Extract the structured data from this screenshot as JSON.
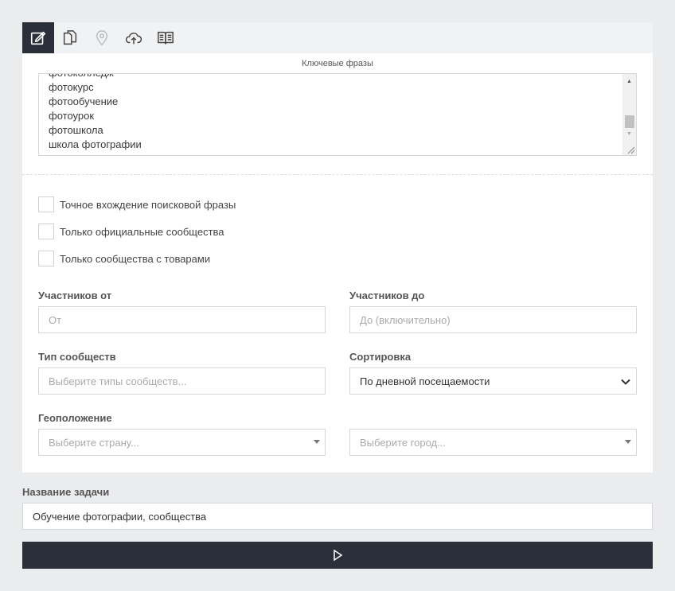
{
  "toolbar": {
    "tools": [
      {
        "icon": "edit-icon",
        "active": true
      },
      {
        "icon": "copy-icon",
        "active": false
      },
      {
        "icon": "location-pin-icon",
        "active": false
      },
      {
        "icon": "cloud-upload-icon",
        "active": false
      },
      {
        "icon": "book-icon",
        "active": false
      }
    ]
  },
  "keywords": {
    "label": "Ключевые фразы",
    "lines": [
      "фотоколледж",
      "фотокурс",
      "фотообучение",
      "фотоурок",
      "фотошкола",
      "школа фотографии"
    ]
  },
  "checkboxes": [
    {
      "label": "Точное вхождение поисковой фразы",
      "checked": false
    },
    {
      "label": "Только официальные сообщества",
      "checked": false
    },
    {
      "label": "Только сообщества с товарами",
      "checked": false
    }
  ],
  "members_from": {
    "label": "Участников от",
    "placeholder": "От"
  },
  "members_to": {
    "label": "Участников до",
    "placeholder": "До (включительно)"
  },
  "community_type": {
    "label": "Тип сообществ",
    "placeholder": "Выберите типы сообществ..."
  },
  "sorting": {
    "label": "Сортировка",
    "value": "По дневной посещаемости"
  },
  "geo": {
    "label": "Геоположение",
    "country_placeholder": "Выберите страну...",
    "city_placeholder": "Выберите город..."
  },
  "task": {
    "label": "Название задачи",
    "value": "Обучение фотографии, сообщества"
  },
  "colors": {
    "dark": "#2a2f3a",
    "background": "#ebecee",
    "panel": "#ffffff"
  }
}
